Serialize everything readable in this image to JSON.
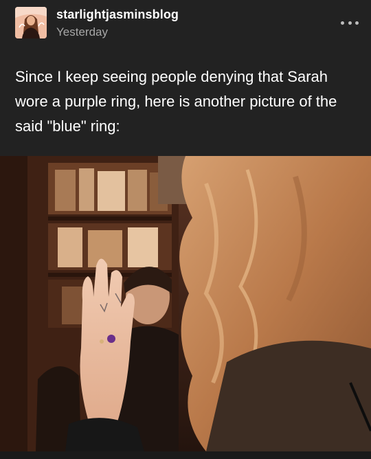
{
  "post": {
    "username": "starlightjasminsblog",
    "timestamp": "Yesterday",
    "caption": "Since I keep seeing people denying that Sarah wore a purple ring, here is another picture of the said \"blue\" ring:",
    "more_icon": "ellipsis-icon",
    "avatar_icon": "blog-avatar"
  },
  "colors": {
    "background": "#222222",
    "text": "#ffffff",
    "muted_text": "#a7a7a7"
  }
}
